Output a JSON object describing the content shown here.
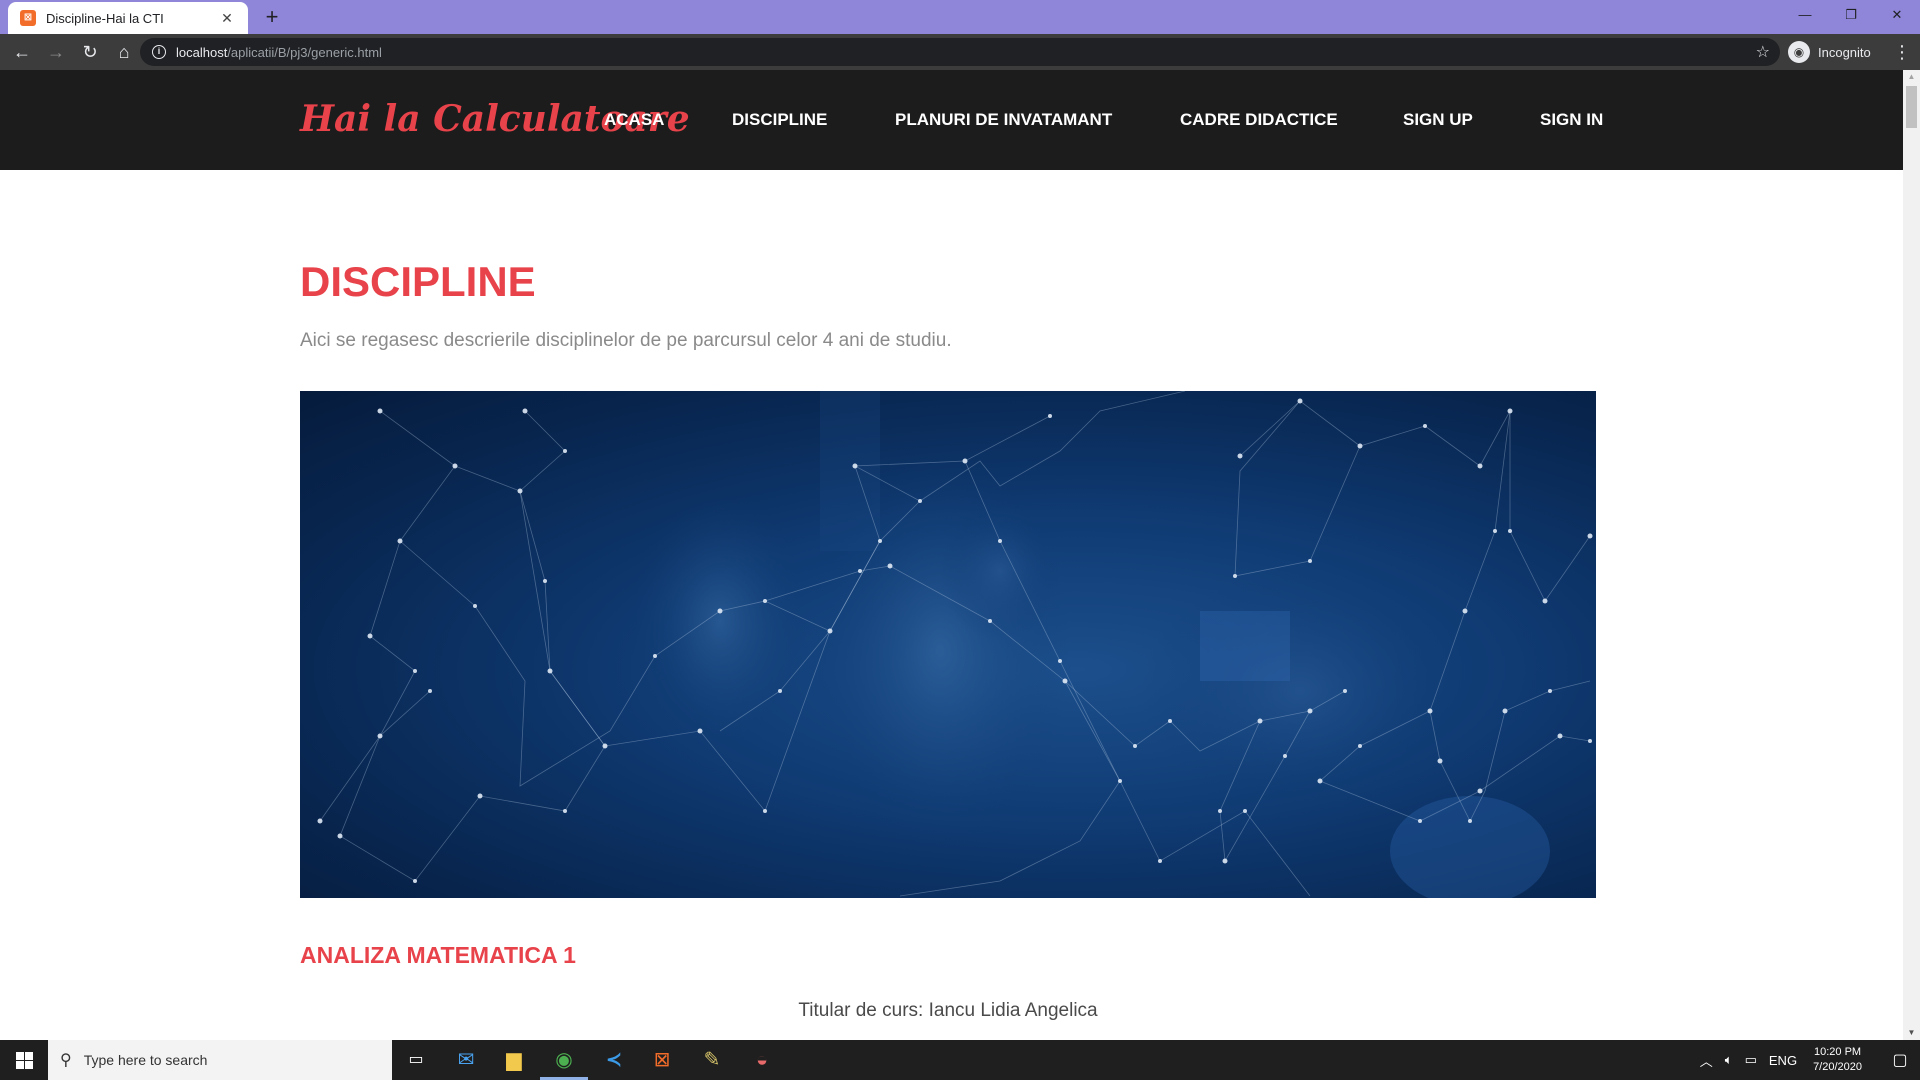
{
  "browser": {
    "tab_title": "Discipline-Hai la CTI",
    "tab_close": "✕",
    "new_tab": "+",
    "favicon_text": "⊠",
    "window_minimize": "—",
    "window_restore": "❐",
    "window_close": "✕",
    "back": "←",
    "forward": "→",
    "reload": "↻",
    "home": "⌂",
    "url_host": "localhost",
    "url_path": "/aplicatii/B/pj3/generic.html",
    "bookmark_star": "☆",
    "profile_label": "Incognito",
    "menu": "⋮"
  },
  "site": {
    "logo": "Hai la Calculatoare",
    "nav": [
      {
        "label": "ACASA"
      },
      {
        "label": "DISCIPLINE"
      },
      {
        "label": "PLANURI DE INVATAMANT"
      },
      {
        "label": "CADRE DIDACTICE"
      },
      {
        "label": "SIGN UP"
      },
      {
        "label": "SIGN IN"
      }
    ],
    "colors": {
      "accent": "#e8434b",
      "header_bg": "#1c1c1c",
      "hero_bg": "#0f3a72"
    }
  },
  "main": {
    "title": "DISCIPLINE",
    "subtitle": "Aici se regasesc descrierile disciplinelor de pe parcursul celor 4 ani de studiu.",
    "hero_image": "network-mesh-over-office-photo",
    "sections": [
      {
        "title": "ANALIZA MATEMATICA 1",
        "instructor_line": "Titular de curs: Iancu Lidia Angelica"
      }
    ]
  },
  "taskbar": {
    "search_placeholder": "Type here to search",
    "language": "ENG",
    "time": "10:20 PM",
    "date": "7/20/2020",
    "apps": [
      "task-view-icon",
      "mail-icon",
      "file-explorer-icon",
      "chrome-icon",
      "vscode-icon",
      "xampp-icon",
      "paint-icon",
      "paint3d-icon"
    ]
  }
}
